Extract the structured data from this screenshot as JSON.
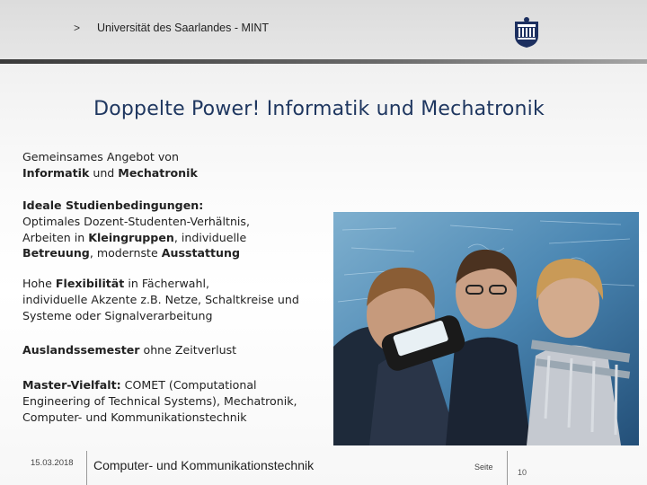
{
  "header": {
    "chevron": ">",
    "title": "Universität des Saarlandes - MINT",
    "logo": "university-seal-icon"
  },
  "slide": {
    "title": "Doppelte Power! Informatik und Mechatronik"
  },
  "bullets": {
    "b1": {
      "l1": "Gemeinsames Angebot von",
      "l2a": "Informatik",
      "l2b": " und ",
      "l2c": "Mechatronik"
    },
    "b2": {
      "l1": "Ideale Studienbedingungen:",
      "l2": "Optimales Dozent-Studenten-Verhältnis,",
      "l3a": "Arbeiten in ",
      "l3b": "Kleingruppen",
      "l3c": ", individuelle",
      "l4a": "Betreuung",
      "l4b": ", modernste ",
      "l4c": "Ausstattung"
    },
    "b3": {
      "l1a": "Hohe ",
      "l1b": "Flexibilität",
      "l1c": " in Fächerwahl,",
      "l2": "individuelle Akzente z.B. Netze, Schaltkreise und",
      "l3": "Systeme oder Signalverarbeitung"
    },
    "b4": {
      "a": "Auslandssemester",
      "b": " ohne Zeitverlust"
    },
    "b5": {
      "l1a": "Master-Vielfalt:",
      "l1b": "  COMET (Computational",
      "l2": "Engineering of Technical Systems), Mechatronik,",
      "l3": "Computer- und Kommunikationstechnik"
    }
  },
  "footer": {
    "date": "15.03.2018",
    "topic": "Computer- und Kommunikationstechnik",
    "page_label": "Seite",
    "page_number": "10"
  },
  "colors": {
    "title": "#1f3760",
    "seal": "#1c2f5f"
  }
}
